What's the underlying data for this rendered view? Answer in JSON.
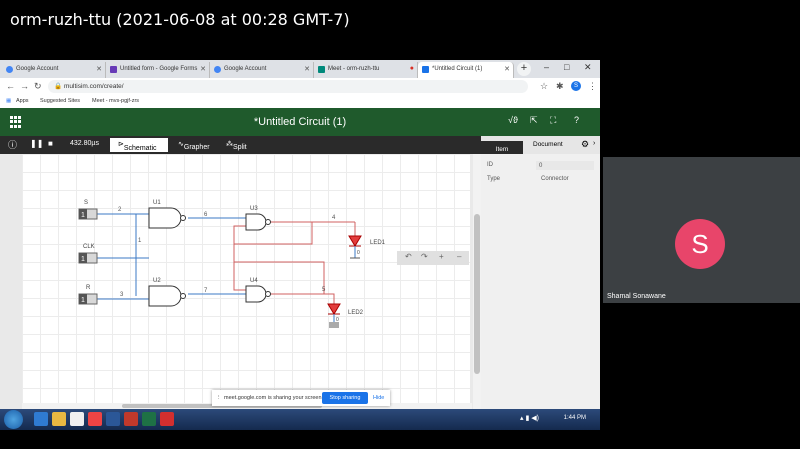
{
  "meeting": {
    "title": "orm-ruzh-ttu (2021-06-08 at 00:28 GMT-7)",
    "participant_name": "Shamal Sonawane",
    "participant_initial": "S",
    "avatar_color": "#e8456a"
  },
  "browser": {
    "tabs": [
      {
        "label": "Google Account",
        "favicon": "google-icon"
      },
      {
        "label": "Untitled form - Google Forms",
        "favicon": "forms-icon"
      },
      {
        "label": "Google Account",
        "favicon": "google-icon"
      },
      {
        "label": "Meet - orm-ruzh-ttu",
        "favicon": "meet-icon"
      },
      {
        "label": "*Untitled Circuit (1)",
        "favicon": "multisim-icon"
      }
    ],
    "url": "multisim.com/create/",
    "bookmarks": [
      "Apps",
      "Suggested Sites",
      "Meet - mvs-pgjf-zrs"
    ],
    "profile_initial": "S"
  },
  "multisim": {
    "title": "*Untitled Circuit (1)",
    "header_color": "#1f5a2c",
    "sim_time": "432.80µs",
    "view_tabs": [
      "Schematic",
      "Grapher",
      "Split"
    ],
    "panel_tabs": [
      "Item",
      "Document"
    ],
    "props": [
      {
        "label": "ID",
        "value": "0"
      },
      {
        "label": "Type",
        "value": "Connector"
      }
    ],
    "schematic": {
      "inputs": [
        {
          "name": "S",
          "state": "1"
        },
        {
          "name": "CLK",
          "state": "1"
        },
        {
          "name": "R",
          "state": "1"
        }
      ],
      "gates": [
        "U1",
        "U2",
        "U3",
        "U4"
      ],
      "nets": [
        "2",
        "6",
        "1",
        "3",
        "7",
        "4",
        "5"
      ],
      "leds": [
        {
          "name": "LED1",
          "pin": "0"
        },
        {
          "name": "LED2",
          "pin": "0"
        }
      ]
    }
  },
  "share_banner": {
    "message": "meet.google.com is sharing your screen.",
    "stop_label": "Stop sharing",
    "hide_label": "Hide"
  },
  "taskbar": {
    "time": "1:44 PM"
  }
}
